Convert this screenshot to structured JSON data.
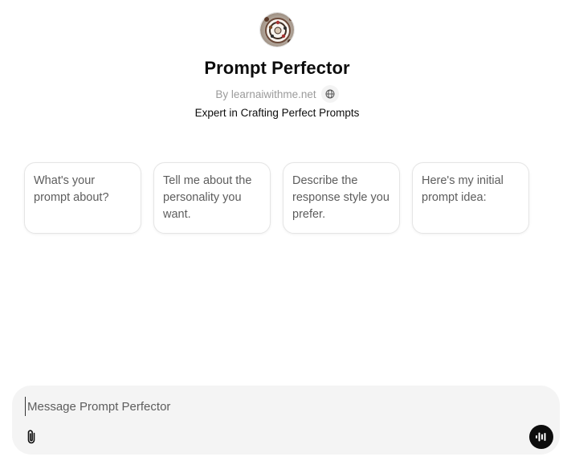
{
  "gpt": {
    "avatar_icon": "decorated-plate-image",
    "name": "Prompt Perfector",
    "byline": "By learnaiwithme.net",
    "byline_icon": "globe-icon",
    "description": "Expert in Crafting Perfect Prompts"
  },
  "starters": [
    {
      "label": "What's your prompt about?"
    },
    {
      "label": "Tell me about the personality you want."
    },
    {
      "label": "Describe the response style you prefer."
    },
    {
      "label": "Here's my initial prompt idea:"
    }
  ],
  "composer": {
    "placeholder": "Message Prompt Perfector",
    "attach_icon": "paperclip-icon",
    "voice_icon": "voice-waveform-icon"
  }
}
